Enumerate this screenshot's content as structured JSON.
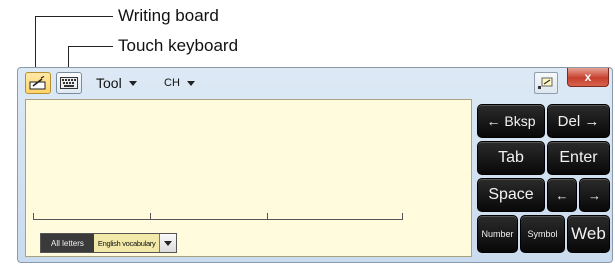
{
  "callouts": {
    "writing_board": "Writing board",
    "touch_keyboard": "Touch keyboard"
  },
  "toolbar": {
    "writing_board_button": "pen-pad-icon",
    "touch_keyboard_button": "keyboard-icon",
    "tool_menu": "Tool",
    "language_menu": "CH",
    "close_symbol": "x"
  },
  "writing_pad": {
    "mode_options": [
      "All letters",
      "English vocabulary"
    ],
    "selected_mode": "All letters"
  },
  "keys": {
    "backspace": "← Bksp",
    "delete": "Del →",
    "tab": "Tab",
    "enter": "Enter",
    "space": "Space",
    "left": "←",
    "right": "→",
    "number": "Number",
    "symbol": "Symbol",
    "web": "Web"
  },
  "colors": {
    "pad_background": "#fffbdc",
    "key_background": "#111111",
    "close_button": "#c7402d",
    "active_tool": "#ffd46a"
  }
}
